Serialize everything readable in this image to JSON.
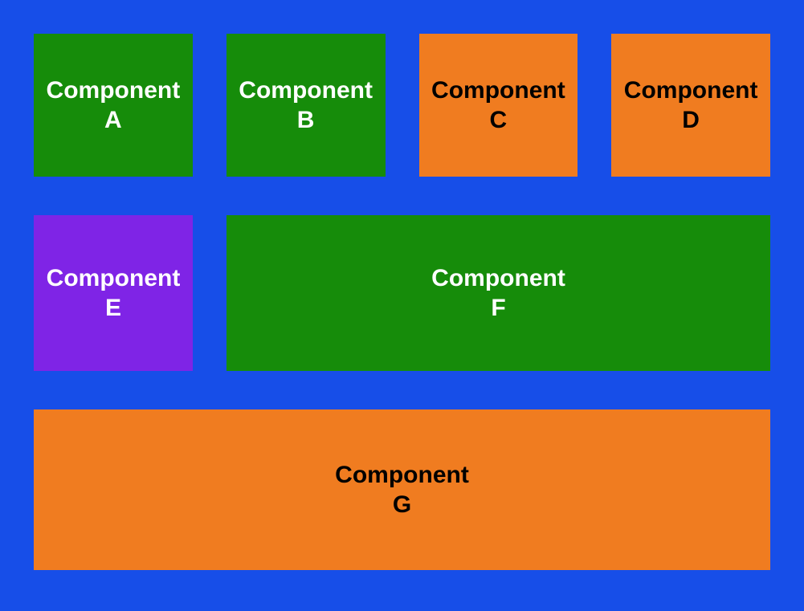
{
  "components": {
    "a": {
      "line1": "Component",
      "line2": "A"
    },
    "b": {
      "line1": "Component",
      "line2": "B"
    },
    "c": {
      "line1": "Component",
      "line2": "C"
    },
    "d": {
      "line1": "Component",
      "line2": "D"
    },
    "e": {
      "line1": "Component",
      "line2": "E"
    },
    "f": {
      "line1": "Component",
      "line2": "F"
    },
    "g": {
      "line1": "Component",
      "line2": "G"
    }
  },
  "colors": {
    "background": "#174ee8",
    "green": "#168c0a",
    "orange": "#f07c20",
    "purple": "#7f24e6"
  }
}
